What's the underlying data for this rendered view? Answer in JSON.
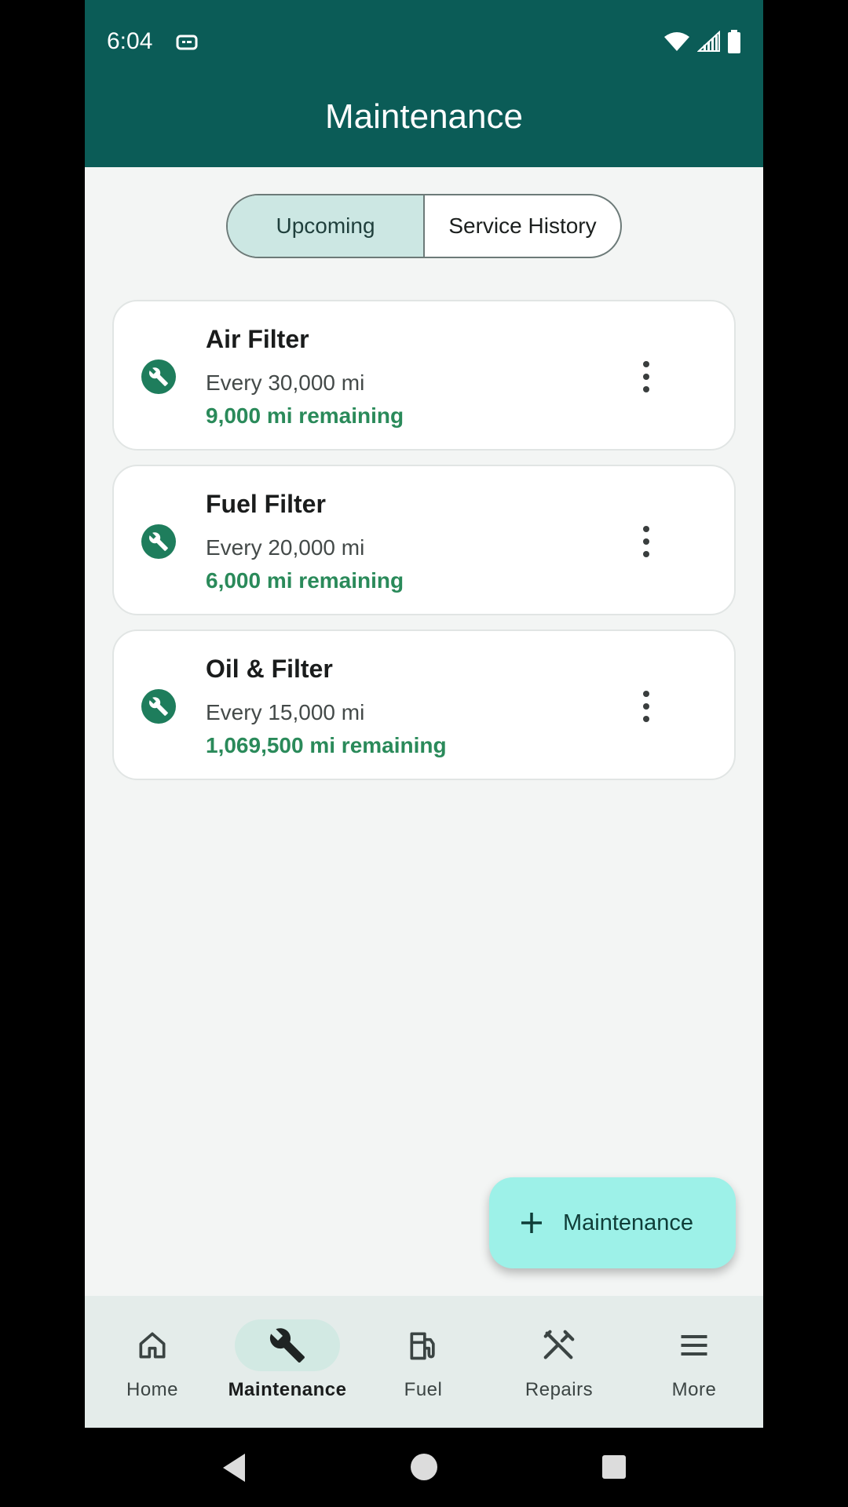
{
  "status_bar": {
    "time": "6:04"
  },
  "app_bar": {
    "title": "Maintenance"
  },
  "segments": {
    "upcoming": "Upcoming",
    "history": "Service History"
  },
  "items": [
    {
      "name": "Air Filter",
      "interval": "Every 30,000 mi",
      "remaining": "9,000 mi remaining"
    },
    {
      "name": "Fuel Filter",
      "interval": "Every 20,000 mi",
      "remaining": "6,000 mi remaining"
    },
    {
      "name": "Oil & Filter",
      "interval": "Every 15,000 mi",
      "remaining": "1,069,500 mi remaining"
    }
  ],
  "fab": {
    "label": "Maintenance",
    "icon": "plus-icon"
  },
  "bottom_nav": [
    {
      "label": "Home",
      "icon": "home-icon"
    },
    {
      "label": "Maintenance",
      "icon": "wrench-icon"
    },
    {
      "label": "Fuel",
      "icon": "fuel-pump-icon"
    },
    {
      "label": "Repairs",
      "icon": "tools-icon"
    },
    {
      "label": "More",
      "icon": "menu-icon"
    }
  ],
  "colors": {
    "app_bar": "#0b5c57",
    "accent_green": "#2a8a5a",
    "fab": "#9df1e8",
    "selected_segment": "#cce7e3"
  }
}
